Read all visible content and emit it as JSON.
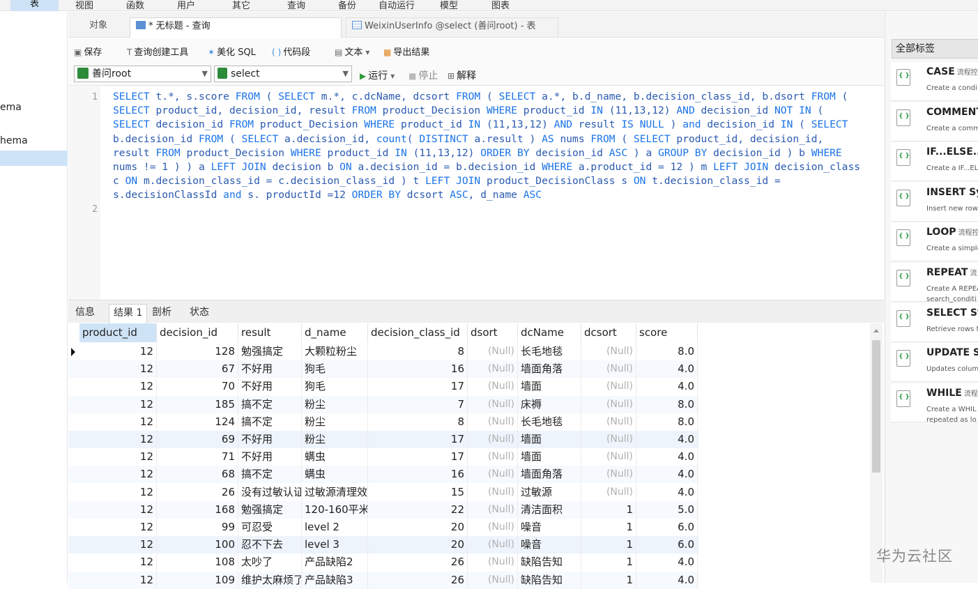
{
  "menubar": {
    "items": [
      "表",
      "视图",
      "函数",
      "用户",
      "其它",
      "查询",
      "备份",
      "自动运行",
      "模型",
      "图表"
    ]
  },
  "leftnav": {
    "items": [
      "ema",
      "hema"
    ]
  },
  "tabs": [
    {
      "label": "对象"
    },
    {
      "label": "* 无标题 - 查询"
    },
    {
      "label": "WeixinUserInfo @select (善问root) - 表"
    }
  ],
  "toolbar": {
    "save": "保存",
    "query_builder": "查询创建工具",
    "beautify": "美化 SQL",
    "snippet": "代码段",
    "text": "文本",
    "export": "导出结果"
  },
  "connection": {
    "value": "善问root"
  },
  "database": {
    "value": "select"
  },
  "run": {
    "run": "运行",
    "stop": "停止",
    "explain": "解释"
  },
  "editor": {
    "line_numbers": [
      "1",
      "2"
    ],
    "sql": "SELECT t.*, s.score FROM ( SELECT m.*, c.dcName, dcsort FROM ( SELECT a.*, b.d_name, b.decision_class_id, b.dsort FROM ( SELECT product_id, decision_id, result FROM product_Decision WHERE product_id IN (11,13,12) AND decision_id NOT IN ( SELECT decision_id FROM product_Decision WHERE product_id IN (11,13,12) AND result IS NULL ) and decision_id IN ( SELECT b.decision_id FROM ( SELECT a.decision_id, count( DISTINCT a.result ) AS nums FROM ( SELECT product_id, decision_id, result FROM product_Decision WHERE product_id IN (11,13,12) ORDER BY decision_id ASC ) a GROUP BY decision_id ) b WHERE nums != 1 ) ) a LEFT JOIN decision b ON a.decision_id = b.decision_id WHERE a.product_id = 12 ) m LEFT JOIN decision_class c ON m.decision_class_id = c.decision_class_id ) t LEFT JOIN product_DecisionClass s ON t.decision_class_id = s.decisionClassId and s. productId =12 ORDER BY dcsort ASC, d_name ASC"
  },
  "result_tabs": [
    "信息",
    "结果 1",
    "剖析",
    "状态"
  ],
  "grid": {
    "columns": [
      "product_id",
      "decision_id",
      "result",
      "d_name",
      "decision_class_id",
      "dsort",
      "dcName",
      "dcsort",
      "score"
    ],
    "rows": [
      [
        "12",
        "128",
        "勉强搞定",
        "大颗粒粉尘",
        "8",
        "(Null)",
        "长毛地毯",
        "(Null)",
        "8.0"
      ],
      [
        "12",
        "67",
        "不好用",
        "狗毛",
        "16",
        "(Null)",
        "墙面角落",
        "(Null)",
        "4.0"
      ],
      [
        "12",
        "70",
        "不好用",
        "狗毛",
        "17",
        "(Null)",
        "墙面",
        "(Null)",
        "4.0"
      ],
      [
        "12",
        "185",
        "搞不定",
        "粉尘",
        "7",
        "(Null)",
        "床褥",
        "(Null)",
        "8.0"
      ],
      [
        "12",
        "124",
        "搞不定",
        "粉尘",
        "8",
        "(Null)",
        "长毛地毯",
        "(Null)",
        "8.0"
      ],
      [
        "12",
        "69",
        "不好用",
        "粉尘",
        "17",
        "(Null)",
        "墙面",
        "(Null)",
        "4.0"
      ],
      [
        "12",
        "71",
        "不好用",
        "螨虫",
        "17",
        "(Null)",
        "墙面",
        "(Null)",
        "4.0"
      ],
      [
        "12",
        "68",
        "搞不定",
        "螨虫",
        "16",
        "(Null)",
        "墙面角落",
        "(Null)",
        "4.0"
      ],
      [
        "12",
        "26",
        "没有过敏认证",
        "过敏源清理效",
        "15",
        "(Null)",
        "过敏源",
        "(Null)",
        "4.0"
      ],
      [
        "12",
        "168",
        "勉强搞定",
        "120-160平米",
        "22",
        "(Null)",
        "清洁面积",
        "1",
        "5.0"
      ],
      [
        "12",
        "99",
        "可忍受",
        "level 2",
        "20",
        "(Null)",
        "噪音",
        "1",
        "6.0"
      ],
      [
        "12",
        "100",
        "忍不下去",
        "level 3",
        "20",
        "(Null)",
        "噪音",
        "1",
        "6.0"
      ],
      [
        "12",
        "108",
        "太吵了",
        "产品缺陷2",
        "26",
        "(Null)",
        "缺陷告知",
        "1",
        "4.0"
      ],
      [
        "12",
        "109",
        "维护太麻烦了",
        "产品缺陷3",
        "26",
        "(Null)",
        "缺陷告知",
        "1",
        "4.0"
      ]
    ]
  },
  "snippets": {
    "filter": "全部标签",
    "items": [
      {
        "title": "CASE",
        "tag": "流程控",
        "desc": [
          "Create a condi"
        ]
      },
      {
        "title": "COMMENT",
        "tag": "",
        "desc": [
          "Create a comm"
        ]
      },
      {
        "title": "IF...ELSE...",
        "tag": "",
        "desc": [
          "Create a IF...ELS"
        ]
      },
      {
        "title": "INSERT Sy",
        "tag": "",
        "desc": [
          "Insert new row"
        ]
      },
      {
        "title": "LOOP",
        "tag": "流程控",
        "desc": [
          "Create a simple"
        ]
      },
      {
        "title": "REPEAT",
        "tag": "流",
        "desc": [
          "Create A REPEA",
          "search_conditi"
        ]
      },
      {
        "title": "SELECT Sy",
        "tag": "",
        "desc": [
          "Retrieve rows f"
        ]
      },
      {
        "title": "UPDATE S",
        "tag": "",
        "desc": [
          "Updates colum"
        ]
      },
      {
        "title": "WHILE",
        "tag": "流程",
        "desc": [
          "Create a WHIL",
          "repeated as lo"
        ]
      }
    ]
  },
  "watermark": "华为云社区"
}
